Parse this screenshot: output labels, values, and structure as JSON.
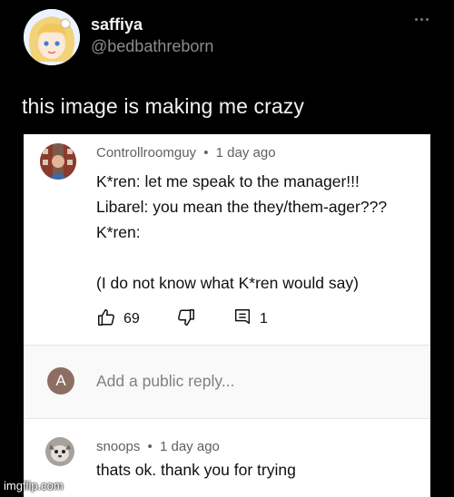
{
  "tweet": {
    "display_name": "saffiya",
    "handle": "@bedbathreborn",
    "text": "this image is making me crazy",
    "more_icon": "ellipsis-icon"
  },
  "comment": {
    "author": "Controllroomguy",
    "time": "1 day ago",
    "separator": "•",
    "lines": [
      "K*ren: let me speak to the manager!!!",
      "Libarel: you mean the they/them-ager???",
      "K*ren:",
      "",
      "(I do not know what K*ren would say)"
    ],
    "likes": "69",
    "replies": "1",
    "icons": {
      "like": "thumbs-up-icon",
      "dislike": "thumbs-down-icon",
      "reply": "reply-comment-icon"
    }
  },
  "reply_box": {
    "avatar_letter": "A",
    "avatar_color": "#8d6e63",
    "placeholder": "Add a public reply..."
  },
  "reply": {
    "author": "snoops",
    "time": "1 day ago",
    "separator": "•",
    "text": "thats ok. thank you for trying"
  },
  "watermark": "imgflip.com"
}
